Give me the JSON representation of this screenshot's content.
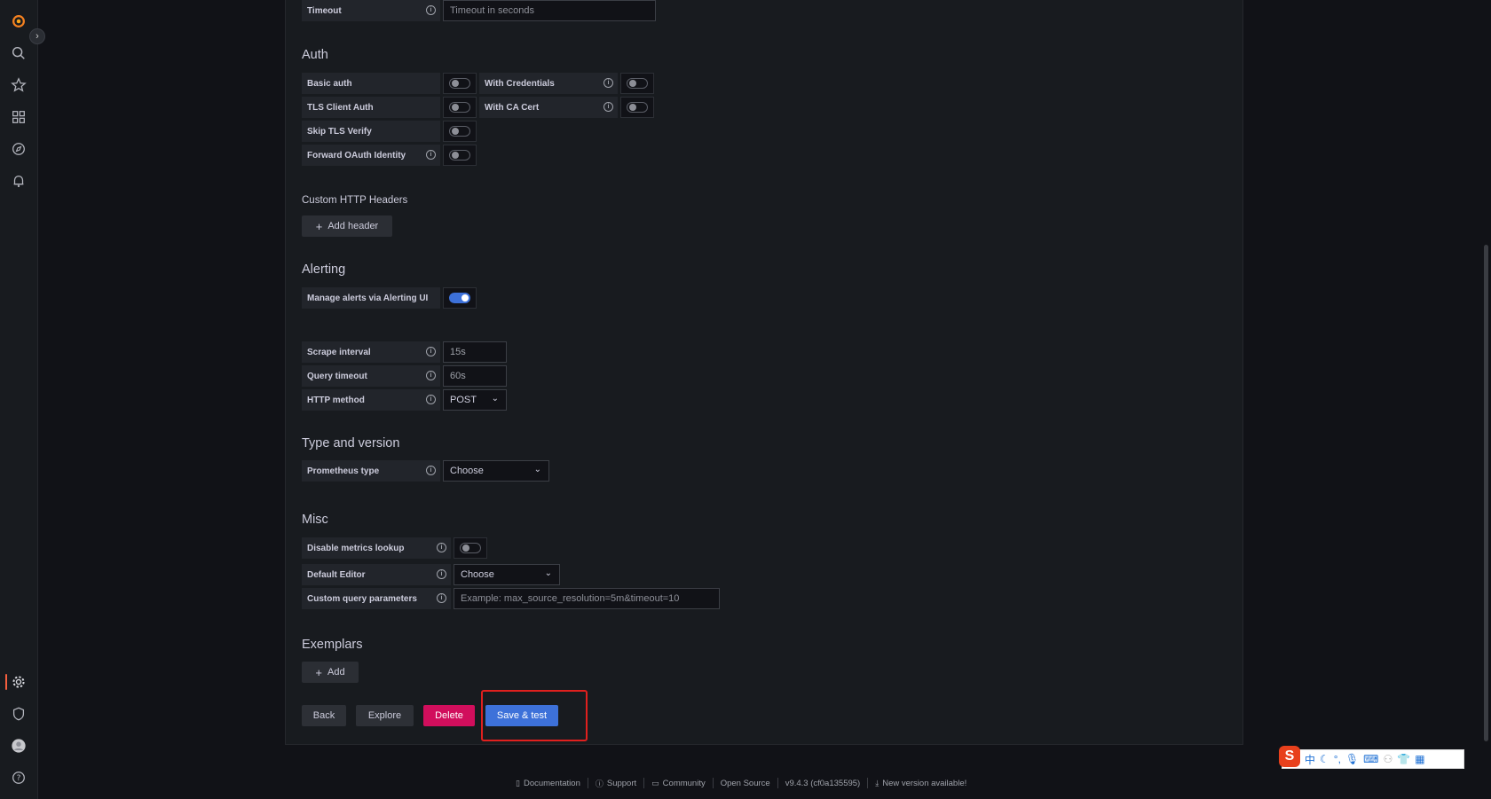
{
  "fields": {
    "timeout": {
      "label": "Timeout",
      "placeholder": "Timeout in seconds"
    },
    "basic_auth": "Basic auth",
    "with_credentials": "With Credentials",
    "tls_client_auth": "TLS Client Auth",
    "with_ca_cert": "With CA Cert",
    "skip_tls_verify": "Skip TLS Verify",
    "forward_oauth": "Forward OAuth Identity",
    "manage_alerts": "Manage alerts via Alerting UI",
    "scrape_interval": {
      "label": "Scrape interval",
      "value": "15s"
    },
    "query_timeout": {
      "label": "Query timeout",
      "value": "60s"
    },
    "http_method": {
      "label": "HTTP method",
      "value": "POST"
    },
    "prometheus_type": {
      "label": "Prometheus type",
      "value": "Choose"
    },
    "disable_metrics_lookup": "Disable metrics lookup",
    "default_editor": {
      "label": "Default Editor",
      "value": "Choose"
    },
    "custom_query_params": {
      "label": "Custom query parameters",
      "placeholder": "Example: max_source_resolution=5m&timeout=10"
    }
  },
  "toggles": {
    "basic_auth": false,
    "with_credentials": false,
    "tls_client_auth": false,
    "with_ca_cert": false,
    "skip_tls_verify": false,
    "forward_oauth": false,
    "manage_alerts": true,
    "disable_metrics_lookup": false
  },
  "sections": {
    "auth": "Auth",
    "custom_headers": "Custom HTTP Headers",
    "alerting": "Alerting",
    "type_version": "Type and version",
    "misc": "Misc",
    "exemplars": "Exemplars"
  },
  "buttons": {
    "add_header": "Add header",
    "add": "Add",
    "back": "Back",
    "explore": "Explore",
    "delete": "Delete",
    "save_test": "Save & test"
  },
  "footer": {
    "documentation": "Documentation",
    "support": "Support",
    "community": "Community",
    "open_source": "Open Source",
    "version": "v9.4.3 (cf0a135595)",
    "new_version": "New version available!"
  },
  "ime": {
    "logo": "S",
    "lang": "中"
  },
  "colors": {
    "accent": "#3d71d9",
    "danger": "#d10e5c",
    "highlight": "#e0201e",
    "brand": "#f55f3e"
  }
}
